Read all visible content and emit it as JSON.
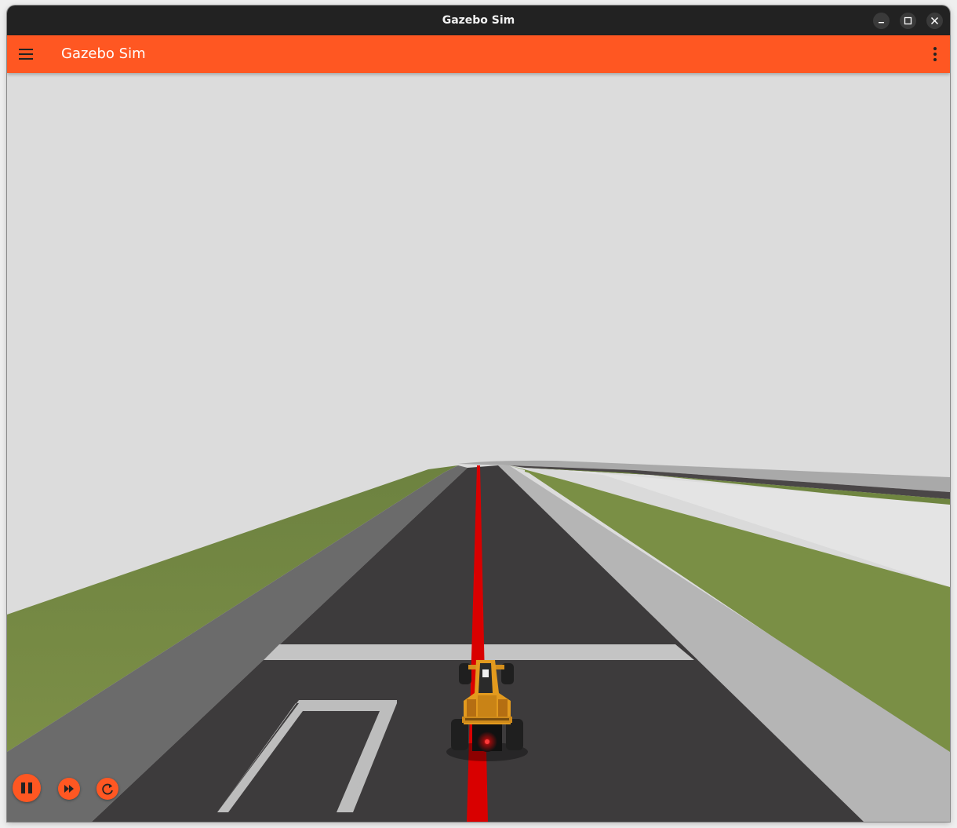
{
  "window": {
    "title": "Gazebo Sim",
    "controls": [
      "minimize-icon",
      "maximize-icon",
      "close-icon"
    ]
  },
  "appbar": {
    "title": "Gazebo Sim",
    "menu_icon": "hamburger-menu-icon",
    "overflow_icon": "kebab-menu-icon"
  },
  "colors": {
    "accent": "#ff5722",
    "titlebar": "#222222",
    "sky": "#dcdcdc",
    "asphalt": "#3d3b3c",
    "grass": "#7a8f45",
    "curb": "#b4b4b4",
    "centerline": "#dd0000",
    "car": "#e39a1e"
  },
  "playback": {
    "buttons": [
      {
        "name": "play-pause-button",
        "icon": "pause-icon"
      },
      {
        "name": "step-button",
        "icon": "fast-forward-icon"
      },
      {
        "name": "reset-button",
        "icon": "reset-icon"
      }
    ]
  }
}
